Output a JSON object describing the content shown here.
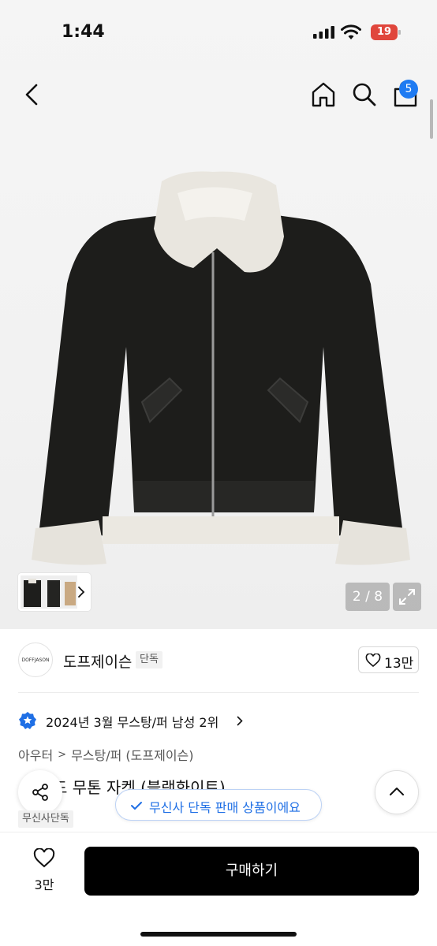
{
  "status_bar": {
    "time": "1:44",
    "battery": "19"
  },
  "nav": {
    "cart_count": "5",
    "icons": [
      "back-icon",
      "home-icon",
      "search-icon",
      "bag-icon"
    ]
  },
  "gallery": {
    "counter": "2 / 8",
    "expand_icon": "expand-icon"
  },
  "brand": {
    "logo_text": "DOFFJASON",
    "name": "도프제이슨",
    "tag": "단독",
    "likes": "13만"
  },
  "ranking": {
    "text": "2024년 3월 무스탕/퍼 남성 2위"
  },
  "breadcrumb": {
    "category": "아우터",
    "subcategory": "무스탕/퍼 (도프제이슨)"
  },
  "product": {
    "title_partial": "드 무톤 자켓 (블랙화이트)",
    "exclusive_tag": "무신사단독"
  },
  "toast": {
    "text": "무신사 단독 판매 상품이에요"
  },
  "bottom_bar": {
    "wish_count": "3만",
    "buy_label": "구매하기"
  },
  "colors": {
    "accent_blue": "#1f6fe5",
    "badge_blue": "#1f7bf2",
    "battery_red": "#e0463c",
    "buy_black": "#000000"
  }
}
